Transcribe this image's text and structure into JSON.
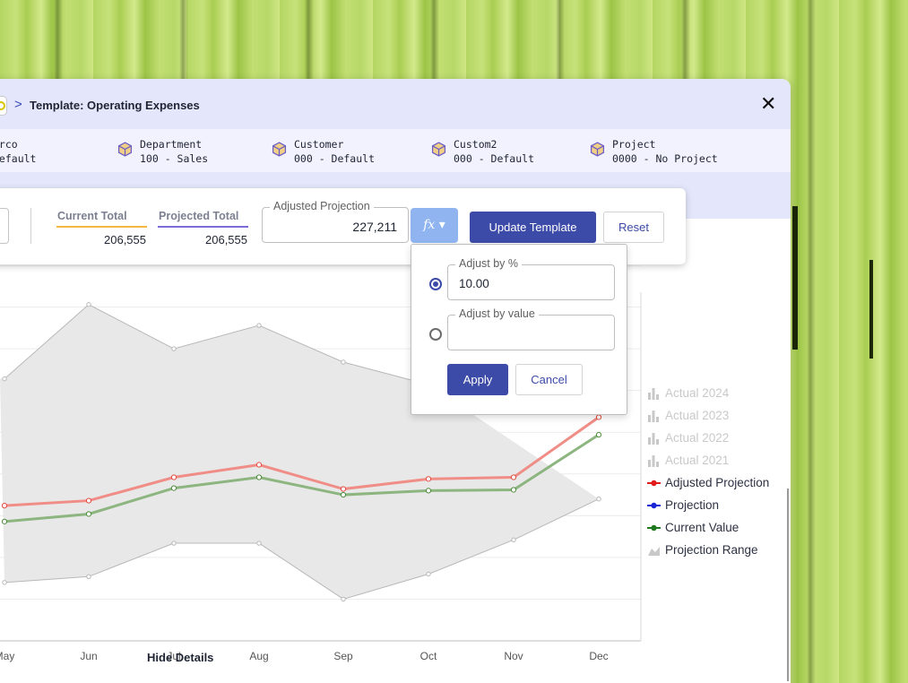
{
  "header": {
    "breadcrumb_title": "Template: Operating Expenses",
    "chevron": ">",
    "close_label": "✕"
  },
  "dimensions": [
    {
      "label": "erco",
      "value": "Default",
      "icon": "none"
    },
    {
      "label": "Department",
      "value": "100 - Sales",
      "icon": "cube-icon"
    },
    {
      "label": "Customer",
      "value": "000 - Default",
      "icon": "cube-icon"
    },
    {
      "label": "Custom2",
      "value": "000 - Default",
      "icon": "cube-icon"
    },
    {
      "label": "Project",
      "value": "0000 - No Project",
      "icon": "cube-icon"
    }
  ],
  "controls": {
    "current_total_label": "Current Total",
    "current_total_value": "206,555",
    "projected_total_label": "Projected Total",
    "projected_total_value": "206,555",
    "adjusted_projection_label": "Adjusted Projection",
    "adjusted_projection_value": "227,211",
    "fx_label": "fx ▾",
    "update_template_label": "Update Template",
    "reset_label": "Reset"
  },
  "adjust_popover": {
    "by_percent_label": "Adjust by %",
    "by_percent_value": "10.00",
    "by_percent_selected": true,
    "by_value_label": "Adjust by value",
    "by_value_value": "",
    "apply_label": "Apply",
    "cancel_label": "Cancel"
  },
  "chart_data": {
    "type": "line",
    "categories": [
      "May",
      "Jun",
      "Jul",
      "Aug",
      "Sep",
      "Oct",
      "Nov",
      "Dec"
    ],
    "series": [
      {
        "name": "Adjusted Projection",
        "color": "#f08d86",
        "marker_color": "#e24a3f",
        "values": [
          16.2,
          16.8,
          19.6,
          21.1,
          18.2,
          19.4,
          19.6,
          26.8
        ]
      },
      {
        "name": "Current Value",
        "color": "#8db57f",
        "marker_color": "#4c8a3a",
        "values": [
          14.3,
          15.2,
          18.3,
          19.6,
          17.5,
          18.0,
          18.1,
          24.7
        ]
      },
      {
        "name": "Projection Range Upper",
        "color": "#b8b8b8",
        "values": [
          31.4,
          40.3,
          35.0,
          37.8,
          33.4,
          30.7,
          null,
          null
        ]
      },
      {
        "name": "Projection Range Lower",
        "color": "#b8b8b8",
        "values": [
          7.0,
          7.7,
          11.7,
          11.7,
          5.0,
          8.0,
          12.1,
          17.0
        ]
      }
    ],
    "projection_range_fill": "#e8e8e8",
    "ylim": [
      0,
      45
    ],
    "grid": true,
    "legend": [
      {
        "name": "Actual 2024",
        "symbol": "bar",
        "color": "#c8c8c8",
        "active": false
      },
      {
        "name": "Actual 2023",
        "symbol": "bar",
        "color": "#c8c8c8",
        "active": false
      },
      {
        "name": "Actual 2022",
        "symbol": "bar",
        "color": "#c8c8c8",
        "active": false
      },
      {
        "name": "Actual 2021",
        "symbol": "bar",
        "color": "#c8c8c8",
        "active": false
      },
      {
        "name": "Adjusted Projection",
        "symbol": "line",
        "color": "#e01b1b",
        "active": true
      },
      {
        "name": "Projection",
        "symbol": "line",
        "color": "#1c25d6",
        "active": true
      },
      {
        "name": "Current Value",
        "symbol": "line",
        "color": "#1f7a1f",
        "active": true
      },
      {
        "name": "Projection Range",
        "symbol": "area",
        "color": "#c8c8c8",
        "active": true
      }
    ],
    "legend_placement": "right"
  },
  "footer": {
    "hide_details_label": "Hide Details"
  }
}
